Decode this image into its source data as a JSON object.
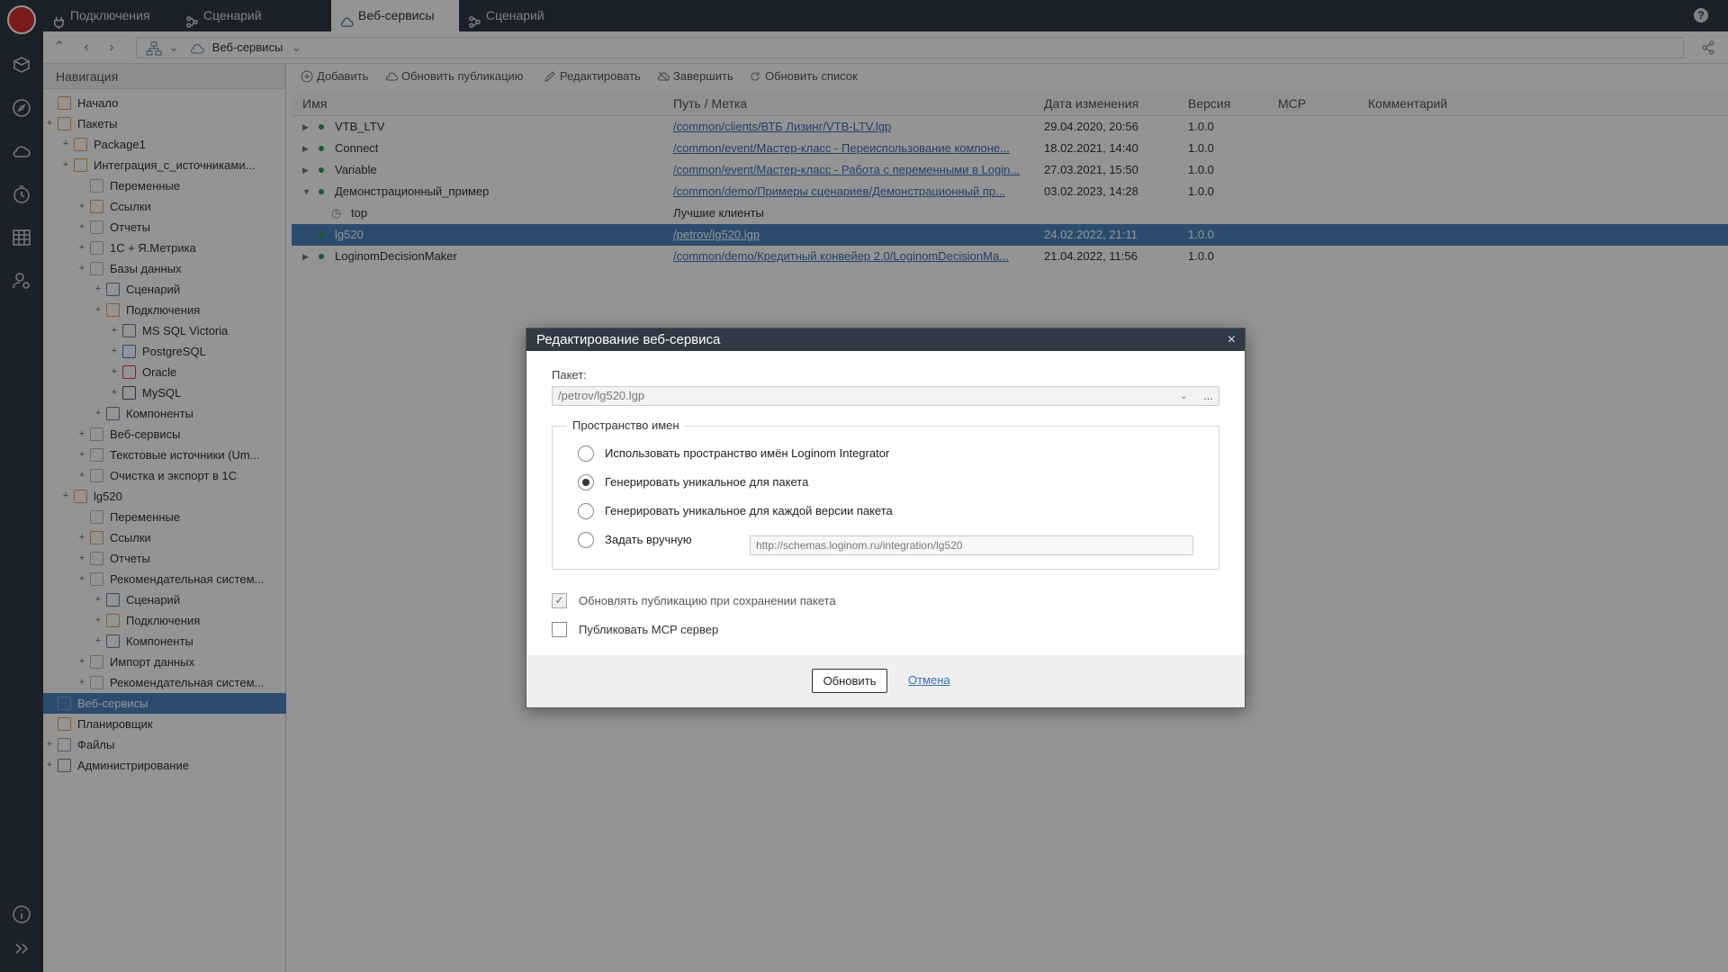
{
  "tabs": [
    {
      "label": "Подключения",
      "icon": "plug-icon"
    },
    {
      "label": "Сценарий",
      "icon": "workflow-icon"
    },
    {
      "label": "Веб-сервисы",
      "icon": "cloud-icon"
    },
    {
      "label": "Сценарий",
      "icon": "workflow-icon"
    }
  ],
  "help_label": "?",
  "address": {
    "path": "Веб-сервисы"
  },
  "nav": {
    "title": "Навигация",
    "items": [
      {
        "label": "Начало"
      },
      {
        "label": "Пакеты"
      },
      {
        "label": "Package1"
      },
      {
        "label": "Интеграция_с_источниками..."
      },
      {
        "label": "Переменные"
      },
      {
        "label": "Ссылки"
      },
      {
        "label": "Отчеты"
      },
      {
        "label": "1С + Я.Метрика"
      },
      {
        "label": "Базы данных"
      },
      {
        "label": "Сценарий"
      },
      {
        "label": "Подключения"
      },
      {
        "label": "MS SQL Victoria"
      },
      {
        "label": "PostgreSQL"
      },
      {
        "label": "Oracle"
      },
      {
        "label": "MySQL"
      },
      {
        "label": "Компоненты"
      },
      {
        "label": "Веб-сервисы"
      },
      {
        "label": "Текстовые источники (Um..."
      },
      {
        "label": "Очистка и экспорт в 1С"
      },
      {
        "label": "lg520"
      },
      {
        "label": "Переменные"
      },
      {
        "label": "Ссылки"
      },
      {
        "label": "Отчеты"
      },
      {
        "label": "Рекомендательная систем..."
      },
      {
        "label": "Сценарий"
      },
      {
        "label": "Подключения"
      },
      {
        "label": "Компоненты"
      },
      {
        "label": "Импорт данных"
      },
      {
        "label": "Рекомендательная систем..."
      },
      {
        "label": "Веб-сервисы"
      },
      {
        "label": "Планировщик"
      },
      {
        "label": "Файлы"
      },
      {
        "label": "Администрирование"
      }
    ]
  },
  "toolbar": {
    "add": "Добавить",
    "update_pub": "Обновить публикацию",
    "edit": "Редактировать",
    "finish": "Завершить",
    "refresh": "Обновить список"
  },
  "table": {
    "columns": [
      "Имя",
      "Путь / Метка",
      "Дата изменения",
      "Версия",
      "MCP",
      "Комментарий"
    ],
    "rows": [
      {
        "name": "VTB_LTV",
        "path": "/common/clients/ВТБ Лизинг/VTB-LTV.lgp",
        "date": "29.04.2020, 20:56",
        "version": "1.0.0"
      },
      {
        "name": "Connect",
        "path": "/common/event/Мастер-класс - Переиспользование компоне...",
        "date": "18.02.2021, 14:40",
        "version": "1.0.0"
      },
      {
        "name": "Variable",
        "path": "/common/event/Мастер-класс - Работа с переменными в Logіn...",
        "date": "27.03.2021, 15:50",
        "version": "1.0.0"
      },
      {
        "name": "Демонстрационный_пример",
        "path": "/common/demo/Примеры сценариев/Демонстрационный пр...",
        "date": "03.02.2023, 14:28",
        "version": "1.0.0"
      },
      {
        "name": "top",
        "path": "Лучшие клиенты",
        "date": "",
        "version": ""
      },
      {
        "name": "lg520",
        "path": "/petrov/lg520.lgp",
        "date": "24.02.2022, 21:11",
        "version": "1.0.0"
      },
      {
        "name": "LoginomDecisionMaker",
        "path": "/common/demo/Кредитный конвейер 2.0/LoginomDecisionMa...",
        "date": "21.04.2022, 11:56",
        "version": "1.0.0"
      }
    ]
  },
  "dialog": {
    "title": "Редактирование веб-сервиса",
    "close": "×",
    "package_label": "Пакет:",
    "package_value": "/petrov/lg520.lgp",
    "package_more": "...",
    "namespace_legend": "Пространство имен",
    "options": [
      "Использовать пространство имён Loginom Integrator",
      "Генерировать уникальное для пакета",
      "Генерировать уникальное для каждой версии пакета",
      "Задать вручную"
    ],
    "selected_option": 1,
    "manual_namespace": "http://schemas.loginom.ru/integration/lg520",
    "update_on_save": "Обновлять публикацию при сохранении пакета",
    "publish_mcp": "Публиковать MCP сервер",
    "ok": "Обновить",
    "cancel": "Отмена"
  },
  "colors": {
    "rail": "#2f3a45",
    "selection": "#4c83c0",
    "link": "#3a70b5",
    "brand": "#d32f2f"
  }
}
